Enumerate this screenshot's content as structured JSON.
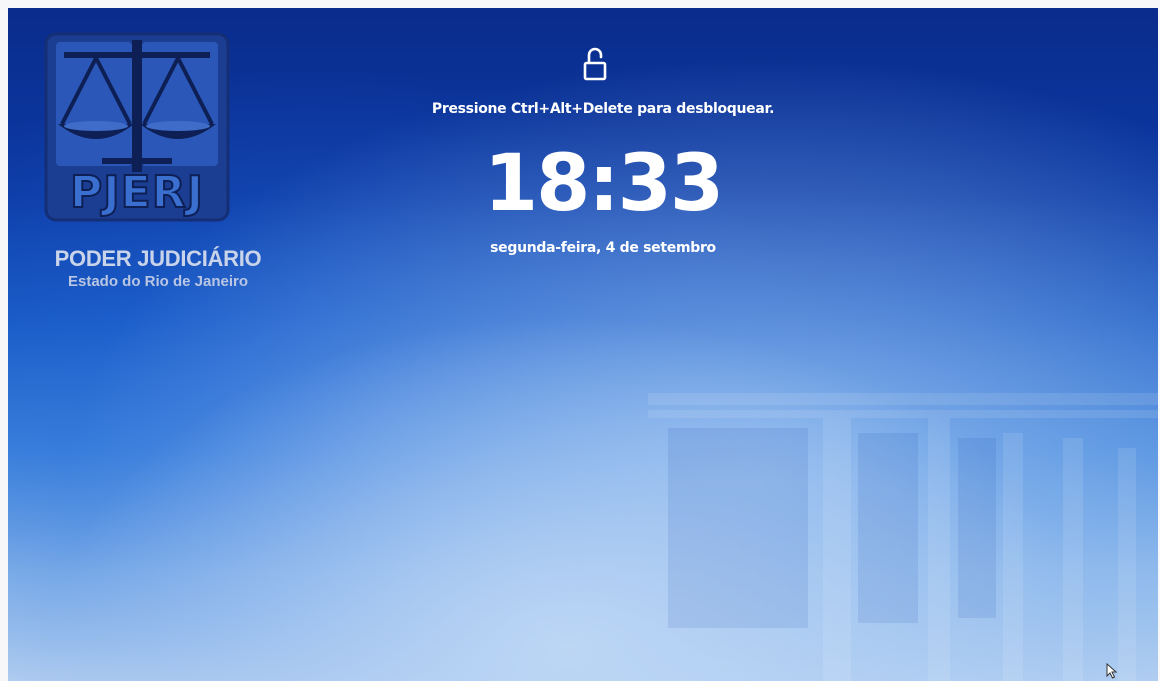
{
  "logo": {
    "abbreviation": "PJERJ",
    "name": "PODER JUDICIÁRIO",
    "subtitle": "Estado do Rio de Janeiro",
    "icon": "scales-of-justice-icon"
  },
  "lock_screen": {
    "lock_icon": "unlock-icon",
    "prompt": "Pressione Ctrl+Alt+Delete para desbloquear.",
    "time": "18:33",
    "date": "segunda-feira, 4 de setembro"
  },
  "colors": {
    "background_top": "#0a2c8c",
    "background_bottom": "#b8d2f1",
    "logo_blue": "#1a3a8e",
    "text": "#ffffff"
  }
}
